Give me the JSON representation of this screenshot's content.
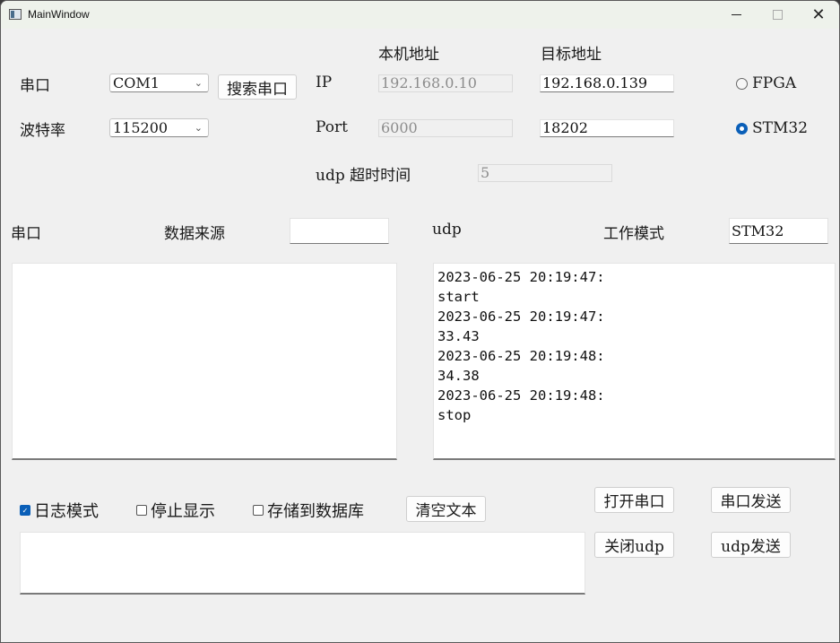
{
  "window": {
    "title": "MainWindow",
    "minimize_icon": "minimize-icon",
    "maximize_icon": "maximize-icon",
    "close_label": "✕"
  },
  "serial_config": {
    "port_label": "串口",
    "port_value": "COM1",
    "baud_label": "波特率",
    "baud_value": "115200",
    "search_button": "搜索串口"
  },
  "network_config": {
    "local_header": "本机地址",
    "target_header": "目标地址",
    "ip_label": "IP",
    "port_label": "Port",
    "local_ip": "192.168.0.10",
    "target_ip": "192.168.0.139",
    "local_port": "6000",
    "target_port": "18202",
    "timeout_label": "udp 超时时间",
    "timeout_value": "5"
  },
  "mode_radios": [
    {
      "label": "FPGA",
      "checked": false
    },
    {
      "label": "STM32",
      "checked": true
    }
  ],
  "serial_panel": {
    "title": "串口",
    "source_label": "数据来源",
    "source_value": "",
    "content": ""
  },
  "udp_panel": {
    "title": "udp",
    "mode_label": "工作模式",
    "mode_value": "STM32",
    "log_lines": [
      "2023-06-25 20:19:47:",
      "start",
      "2023-06-25 20:19:47:",
      "33.43",
      "2023-06-25 20:19:48:",
      "34.38",
      "2023-06-25 20:19:48:",
      "stop"
    ]
  },
  "options": {
    "log_mode": {
      "label": "日志模式",
      "checked": true
    },
    "stop_display": {
      "label": "停止显示",
      "checked": false
    },
    "save_db": {
      "label": "存储到数据库",
      "checked": false
    },
    "clear_button": "清空文本",
    "check_glyph": "✓"
  },
  "send_input": {
    "value": ""
  },
  "actions": {
    "open_serial": "打开串口",
    "serial_send": "串口发送",
    "close_udp": "关闭udp",
    "udp_send": "udp发送"
  },
  "colors": {
    "accent": "#0a5fb8",
    "window_bg": "#f0f0f0",
    "titlebar_bg": "#eef2eb"
  }
}
